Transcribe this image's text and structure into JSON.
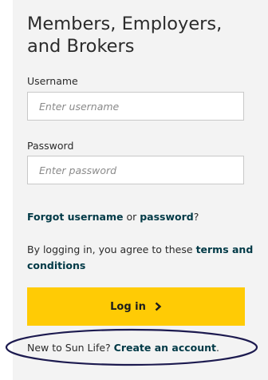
{
  "login": {
    "title": "Members, Employers, and Brokers",
    "username_label": "Username",
    "username_placeholder": "Enter username",
    "password_label": "Password",
    "password_placeholder": "Enter password",
    "forgot_username": "Forgot username",
    "forgot_or": " or ",
    "forgot_password": "password",
    "forgot_question": "?",
    "agree_text": "By logging in, you agree to these ",
    "terms_link": "terms and conditions",
    "login_button": "Log in",
    "new_text": "New to Sun Life? ",
    "create_account": "Create an account",
    "create_period": "."
  },
  "colors": {
    "panel": "#f3f3f3",
    "button": "#ffcb05",
    "link": "#003946",
    "annotation_ellipse": "#1c1a4f"
  },
  "icons": {
    "login_button_icon": "chevron-right-icon"
  }
}
